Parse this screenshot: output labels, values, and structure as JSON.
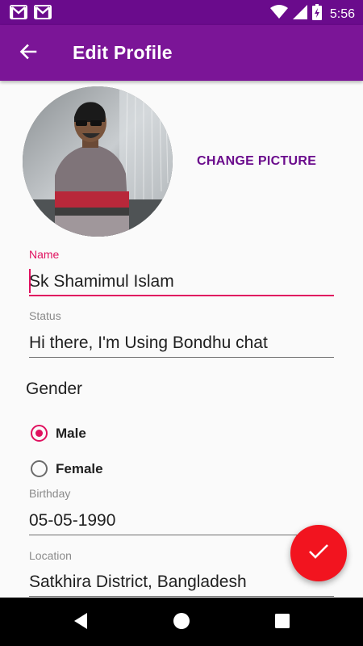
{
  "status_bar": {
    "time": "5:56"
  },
  "app_bar": {
    "title": "Edit Profile"
  },
  "profile": {
    "change_picture_label": "CHANGE PICTURE"
  },
  "form": {
    "name": {
      "label": "Name",
      "value": "Sk Shamimul Islam"
    },
    "status": {
      "label": "Status",
      "value": "Hi there, I'm Using Bondhu chat"
    },
    "gender": {
      "label": "Gender",
      "options": [
        {
          "label": "Male",
          "selected": true
        },
        {
          "label": "Female",
          "selected": false
        }
      ]
    },
    "birthday": {
      "label": "Birthday",
      "value": "05-05-1990"
    },
    "location": {
      "label": "Location",
      "value": "Satkhira District, Bangladesh"
    }
  },
  "colors": {
    "status_bar": "#6a0b8c",
    "app_bar": "#7b1597",
    "accent": "#e0115f",
    "fab": "#f2141f"
  }
}
